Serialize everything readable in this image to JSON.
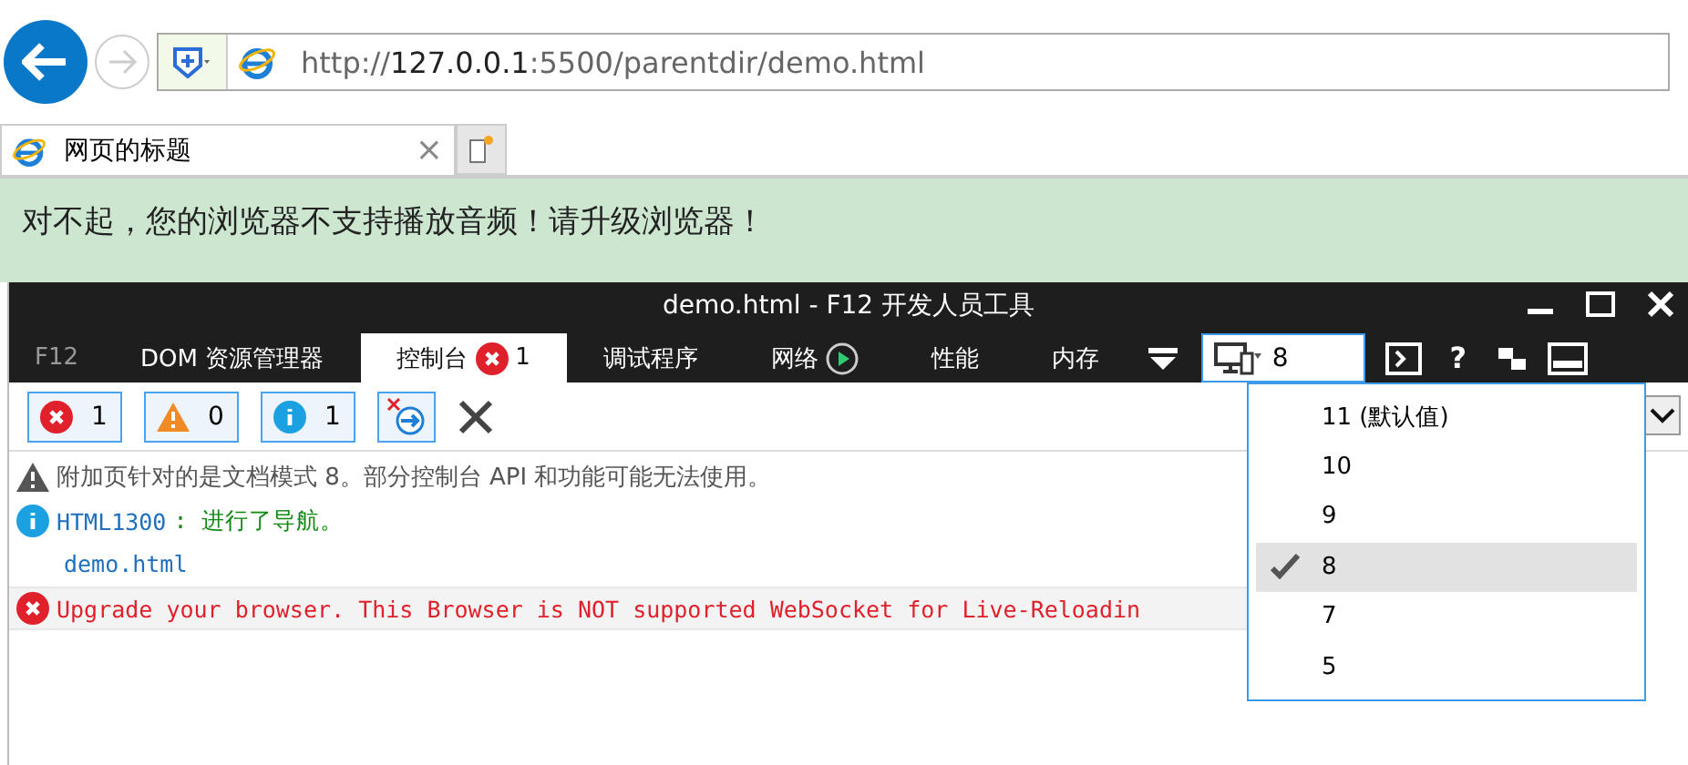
{
  "browser": {
    "url_scheme": "http://",
    "url_host": "127.0.0.1",
    "url_rest": ":5500/parentdir/demo.html",
    "tab_title": "网页的标题",
    "tab_close": "×"
  },
  "page": {
    "message": "对不起，您的浏览器不支持播放音频！请升级浏览器！"
  },
  "devtools": {
    "title": "demo.html - F12 开发人员工具",
    "tabs": [
      {
        "label": "F12",
        "kind": "brand",
        "selected": false
      },
      {
        "label": "DOM 资源管理器",
        "kind": "tab",
        "selected": false
      },
      {
        "label": "控制台",
        "kind": "tab",
        "selected": true,
        "error_count": "1"
      },
      {
        "label": "调试程序",
        "kind": "tab",
        "selected": false
      },
      {
        "label": "网络",
        "kind": "tab",
        "selected": false,
        "play": true
      },
      {
        "label": "性能",
        "kind": "tab",
        "selected": false
      },
      {
        "label": "内存",
        "kind": "tab",
        "selected": false
      }
    ],
    "help": "?",
    "filters": [
      {
        "kind": "error",
        "count": "1"
      },
      {
        "kind": "warning",
        "count": "0"
      },
      {
        "kind": "info",
        "count": "1"
      }
    ],
    "messages": [
      {
        "kind": "warning",
        "text": "附加页针对的是文档模式 8。部分控制台 API 和功能可能无法使用。"
      },
      {
        "kind": "info",
        "code": "HTML1300",
        "text": ": 进行了导航。",
        "link": "demo.html"
      },
      {
        "kind": "error",
        "text": "Upgrade your browser. This Browser is NOT supported WebSocket for Live-Reloadin"
      }
    ],
    "document_mode": {
      "value": "8",
      "options": [
        {
          "label": "11 (默认值)",
          "selected": false
        },
        {
          "label": "10",
          "selected": false
        },
        {
          "label": "9",
          "selected": false
        },
        {
          "label": "8",
          "selected": true
        },
        {
          "label": "7",
          "selected": false
        },
        {
          "label": "5",
          "selected": false
        }
      ]
    }
  }
}
